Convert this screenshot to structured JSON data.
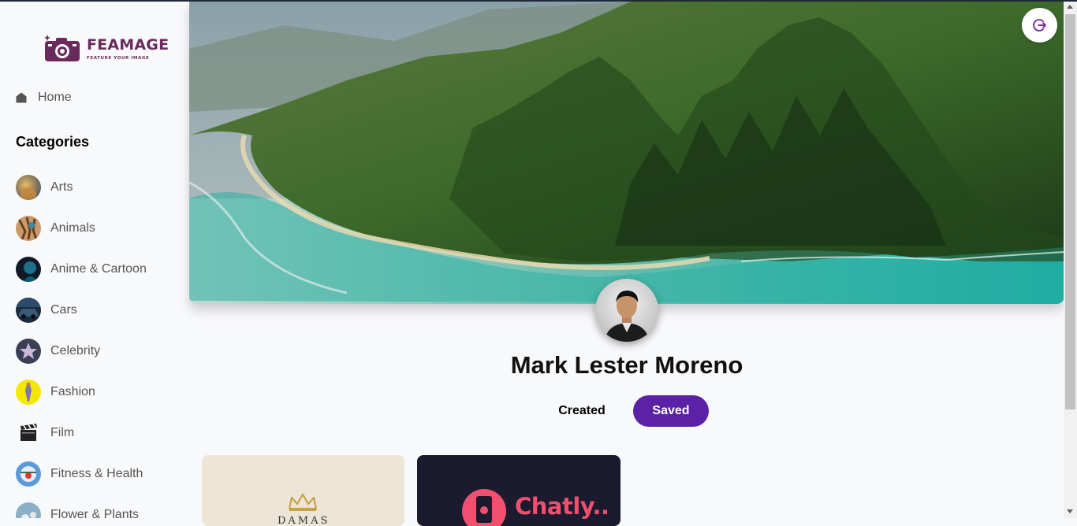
{
  "brand": {
    "name": "FEAMAGE",
    "tagline": "FEATURE YOUR IMAGE",
    "color": "#6b2a5c"
  },
  "sidebar": {
    "home_label": "Home",
    "categories_title": "Categories",
    "categories": [
      {
        "label": "Arts",
        "icon": "arts-thumbnail"
      },
      {
        "label": "Animals",
        "icon": "animals-thumbnail"
      },
      {
        "label": "Anime & Cartoon",
        "icon": "anime-thumbnail"
      },
      {
        "label": "Cars",
        "icon": "cars-thumbnail"
      },
      {
        "label": "Celebrity",
        "icon": "star-thumbnail"
      },
      {
        "label": "Fashion",
        "icon": "fashion-thumbnail"
      },
      {
        "label": "Film",
        "icon": "clapperboard-thumbnail"
      },
      {
        "label": "Fitness & Health",
        "icon": "fitness-thumbnail"
      },
      {
        "label": "Flower & Plants",
        "icon": "flower-thumbnail"
      }
    ]
  },
  "profile": {
    "name": "Mark Lester Moreno",
    "tabs": {
      "created": "Created",
      "saved": "Saved"
    },
    "active_tab": "Saved",
    "accent_color": "#5b21a6"
  },
  "header": {
    "logout_icon": "logout-icon"
  },
  "cards": [
    {
      "text": "DAMAS",
      "icon": "crown-icon"
    },
    {
      "text": "Chatly..",
      "icon": "chat-app-icon"
    }
  ]
}
